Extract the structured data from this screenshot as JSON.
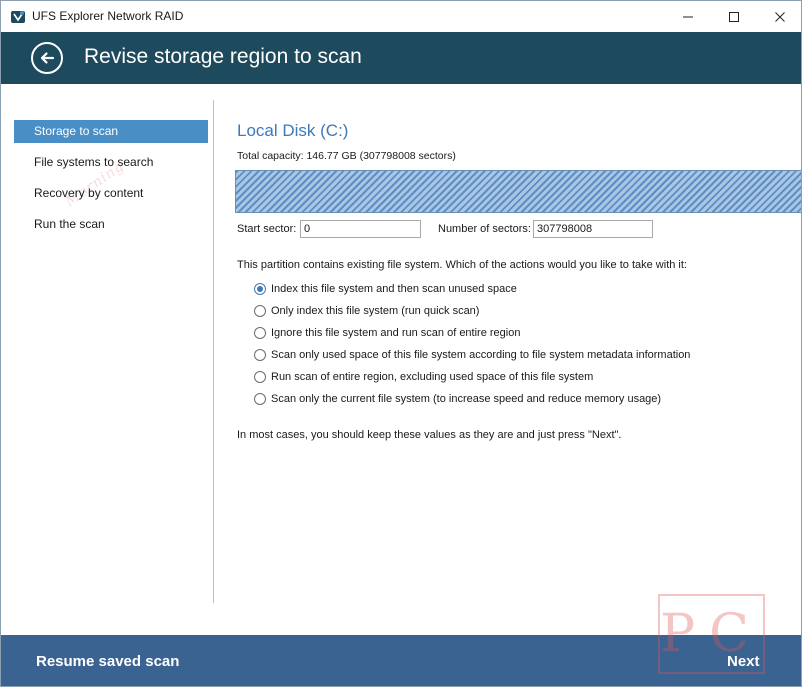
{
  "window": {
    "title": "UFS Explorer Network RAID",
    "controls": {
      "minimize": "—",
      "maximize": "☐",
      "close": "✕"
    }
  },
  "header": {
    "title": "Revise storage region to scan",
    "back_icon": "arrow-left-icon"
  },
  "sidebar": {
    "items": [
      {
        "label": "Storage to scan",
        "active": true
      },
      {
        "label": "File systems to search",
        "active": false
      },
      {
        "label": "Recovery by content",
        "active": false
      },
      {
        "label": "Run the scan",
        "active": false
      }
    ]
  },
  "main": {
    "disk_title": "Local Disk (C:)",
    "capacity": "Total capacity: 146.77 GB (307798008 sectors)",
    "start_sector_label": "Start sector:",
    "start_sector_value": "0",
    "num_sectors_label": "Number of sectors:",
    "num_sectors_value": "307798008",
    "question": "This partition contains existing file system. Which of the actions would you like to take with it:",
    "options": [
      {
        "label": "Index this file system and then scan unused space",
        "checked": true
      },
      {
        "label": "Only index this file system (run quick scan)",
        "checked": false
      },
      {
        "label": "Ignore this file system and run scan of entire region",
        "checked": false
      },
      {
        "label": "Scan only used space of this file system according to file system metadata information",
        "checked": false
      },
      {
        "label": "Run scan of entire region, excluding used space of this file system",
        "checked": false
      },
      {
        "label": "Scan only the current file system (to increase speed and reduce memory usage)",
        "checked": false
      }
    ],
    "hint": "In most cases, you should keep these values as they are and just press \"Next\"."
  },
  "footer": {
    "resume_label": "Resume saved scan",
    "next_label": "Next"
  },
  "colors": {
    "header_bg": "#1e4a5e",
    "footer_bg": "#3a6391",
    "accent": "#3d7ab8",
    "nav_active": "#4a8ec6"
  }
}
